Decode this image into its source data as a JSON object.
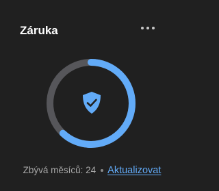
{
  "card": {
    "title": "Záruka",
    "more_icon": "more-horizontal-icon"
  },
  "warranty": {
    "progress_fraction": 0.62,
    "center_icon": "shield-check-icon",
    "remaining_text": "Zbývá měsíců: 24",
    "separator": "•",
    "update_link": "Aktualizovat"
  },
  "colors": {
    "background": "#202020",
    "track": "#56565a",
    "accent": "#62abf8",
    "title": "#ffffff",
    "muted_text": "#a8a8a8"
  }
}
